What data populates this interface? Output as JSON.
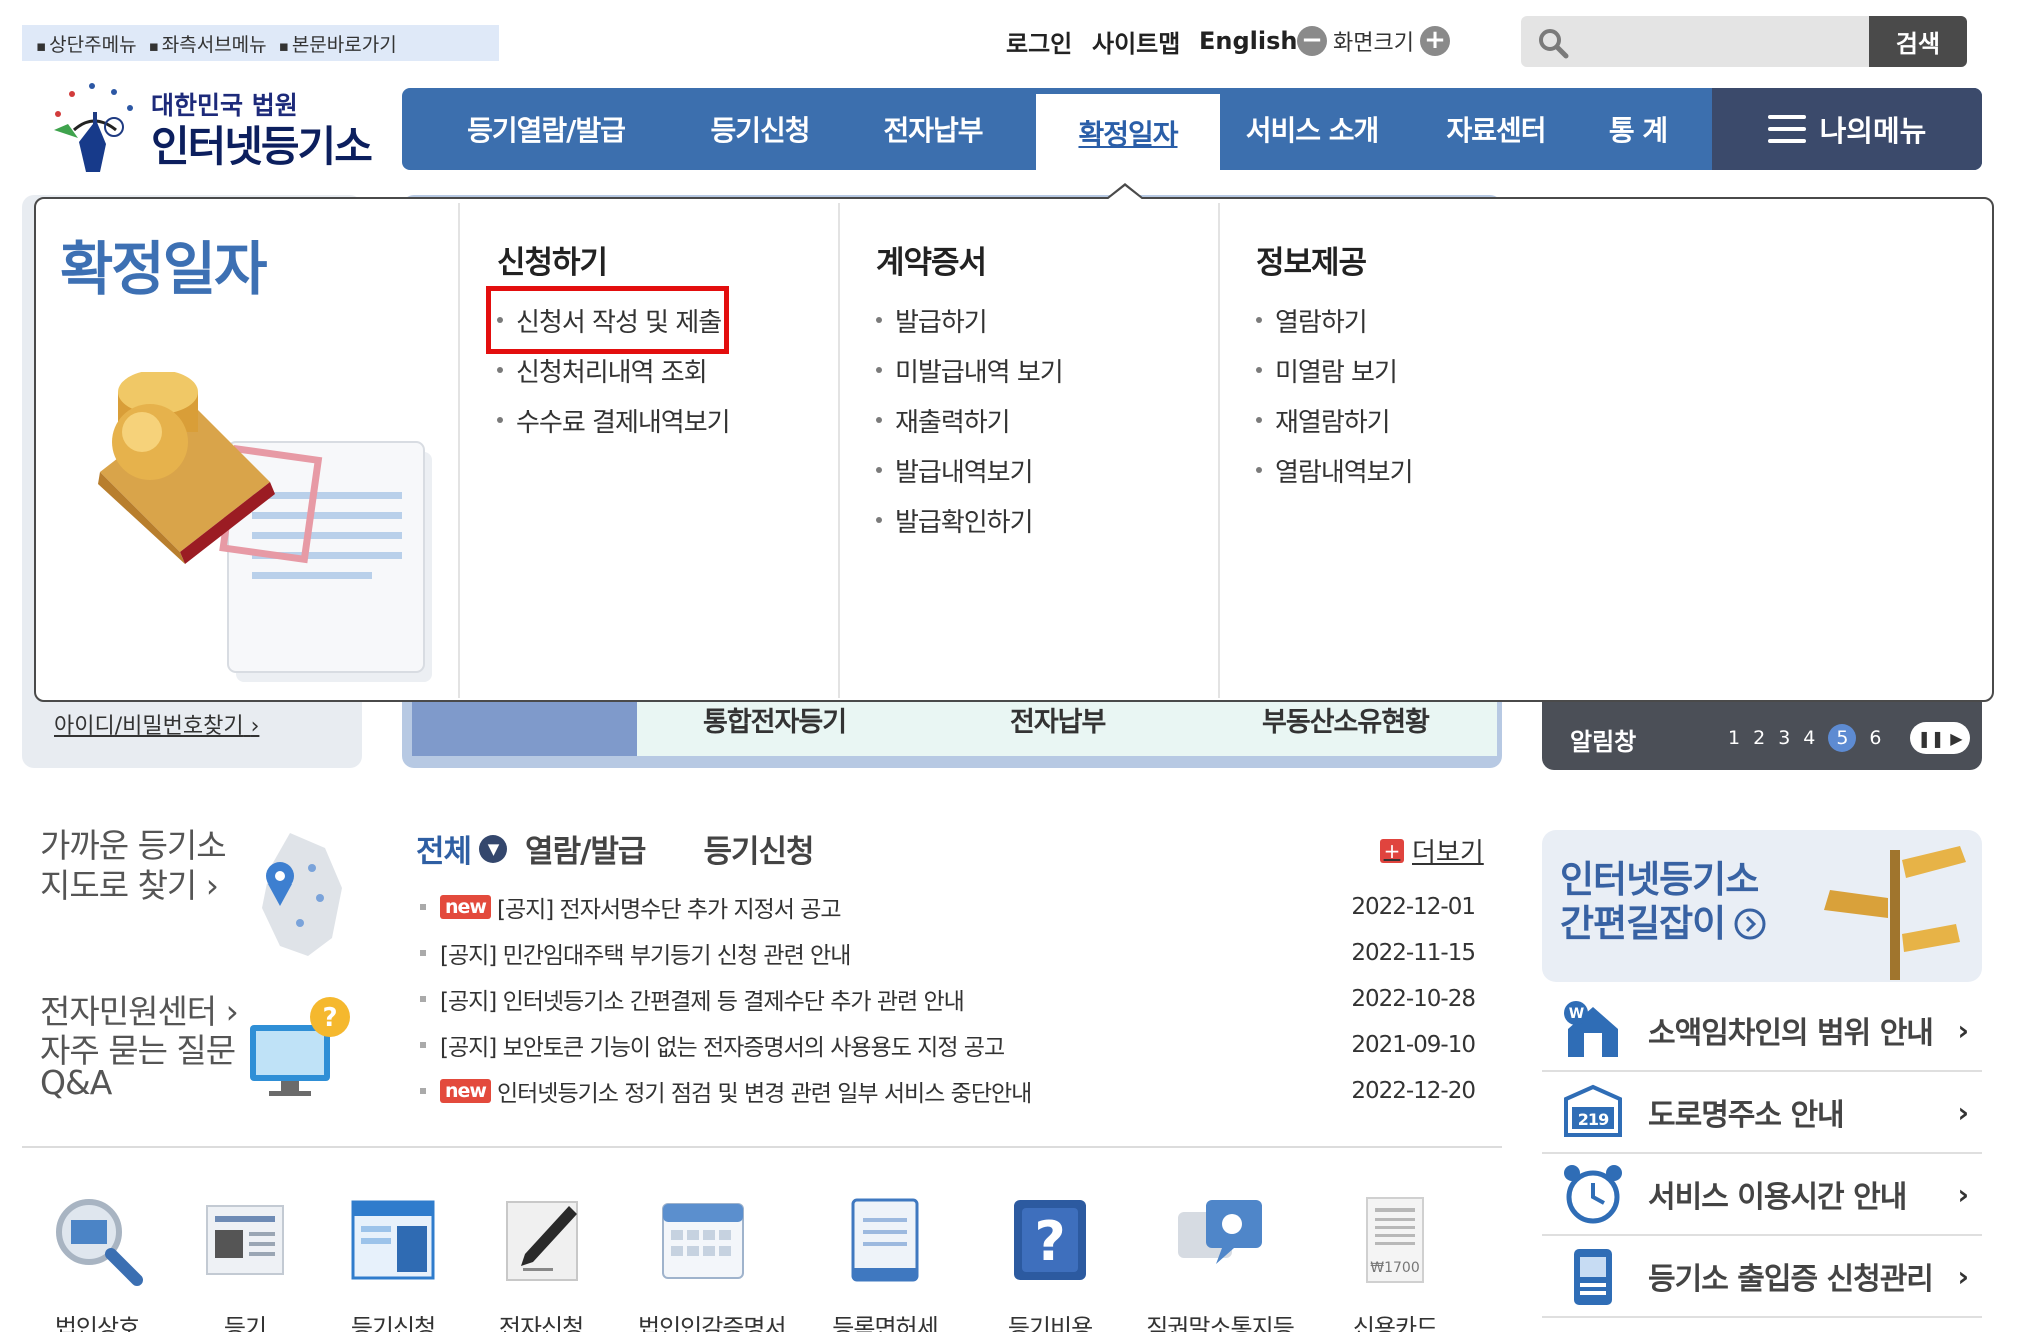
{
  "skip_links": [
    "상단주메뉴",
    "좌측서브메뉴",
    "본문바로가기"
  ],
  "logo": {
    "sub": "대한민국 법원",
    "main": "인터넷등기소"
  },
  "util": {
    "login": "로그인",
    "sitemap": "사이트맵",
    "english": "English",
    "zoom_minus": "−",
    "zoom_label": "화면크기",
    "zoom_plus": "+"
  },
  "search": {
    "placeholder": "",
    "button": "검색"
  },
  "gnb": {
    "items": [
      "등기열람/발급",
      "등기신청",
      "전자납부",
      "확정일자",
      "서비스 소개",
      "자료센터",
      "통 계"
    ],
    "active_index": 3,
    "my_menu": "나의메뉴"
  },
  "dropdown": {
    "title": "확정일자",
    "columns": [
      {
        "heading": "신청하기",
        "items": [
          "신청서 작성 및 제출",
          "신청처리내역 조회",
          "수수료 결제내역보기"
        ]
      },
      {
        "heading": "계약증서",
        "items": [
          "발급하기",
          "미발급내역 보기",
          "재출력하기",
          "발급내역보기",
          "발급확인하기"
        ]
      },
      {
        "heading": "정보제공",
        "items": [
          "열람하기",
          "미열람 보기",
          "재열람하기",
          "열람내역보기"
        ]
      }
    ],
    "highlighted_item": "신청서 작성 및 제출"
  },
  "behind": {
    "find_id": "아이디/비밀번호찾기",
    "find_id_arrow": "›",
    "quick_tabs": [
      "통합전자등기",
      "전자납부",
      "부동산소유현황"
    ],
    "alarm_title": "알림창",
    "pager": [
      "1",
      "2",
      "3",
      "4",
      "5",
      "6"
    ],
    "pager_current": "5",
    "pause": "❚❚",
    "play": "▶"
  },
  "left_links": {
    "near_line1": "가까운 등기소",
    "near_line2": "지도로 찾기",
    "egov": "전자민원센터",
    "faq_line1": "자주 묻는 질문",
    "faq_line2": "Q&A",
    "arrow": "›"
  },
  "notice": {
    "tabs": [
      "전체",
      "열람/발급",
      "등기신청"
    ],
    "more": "더보기",
    "new_badge": "new",
    "rows": [
      {
        "new": true,
        "title": "[공지] 전자서명수단 추가 지정서 공고",
        "date": "2022-12-01"
      },
      {
        "new": false,
        "title": "[공지] 민간임대주택 부기등기 신청 관련 안내",
        "date": "2022-11-15"
      },
      {
        "new": false,
        "title": "[공지] 인터넷등기소 간편결제 등 결제수단 추가 관련 안내",
        "date": "2022-10-28"
      },
      {
        "new": false,
        "title": "[공지] 보안토큰 기능이 없는 전자증명서의 사용용도 지정 공고",
        "date": "2021-09-10"
      },
      {
        "new": true,
        "title": "인터넷등기소 정기 점검 및 변경 관련 일부 서비스 중단안내",
        "date": "2022-12-20"
      }
    ]
  },
  "bottom_icons": [
    "법인상호",
    "등기",
    "등기신청",
    "전자신청",
    "법인인감증명서",
    "등록면허세",
    "등기비용",
    "직권말소통지등",
    "신용카드"
  ],
  "right": {
    "shortcut_line1": "인터넷등기소",
    "shortcut_line2": "간편길잡이",
    "links": [
      "소액임차인의 범위 안내",
      "도로명주소 안내",
      "서비스 이용시간 안내",
      "등기소 출입증 신청관리"
    ],
    "arrow": "›"
  },
  "colors": {
    "primary": "#3c6fae",
    "mymenu": "#3b4a6b",
    "highlight": "#e30e0e",
    "new_badge": "#e34a3c",
    "title_blue": "#3d70b3"
  }
}
